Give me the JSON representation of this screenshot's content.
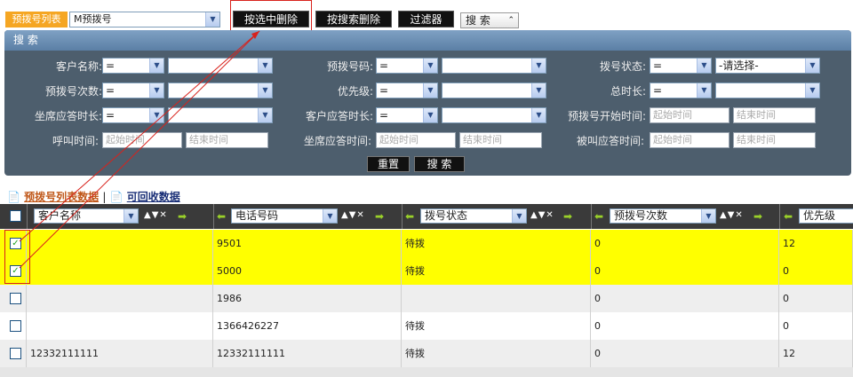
{
  "toolbar": {
    "list_label": "预拨号列表",
    "list_value": "M预拨号",
    "btn_delete_selected": "按选中删除",
    "btn_delete_search": "按搜索删除",
    "btn_filter": "过滤器",
    "search_toggle": "搜 索"
  },
  "panel": {
    "title": "搜 索",
    "op_eq": "=",
    "please_select": "-请选择-",
    "start_time_ph": "起始时间",
    "end_time_ph": "结束时间",
    "labels": {
      "customer_name": "客户名称:",
      "pre_number": "预拨号码:",
      "dial_status": "拨号状态:",
      "dial_count": "预拨号次数:",
      "priority": "优先级:",
      "total_duration": "总时长:",
      "agent_answer": "坐席应答时长:",
      "customer_answer": "客户应答时长:",
      "pre_start_time": "预拨号开始时间:",
      "call_time": "呼叫时间:",
      "agent_answer_time": "坐席应答时间:",
      "called_answer_time": "被叫应答时间:"
    },
    "reset": "重置",
    "search": "搜 索"
  },
  "tabs": {
    "active": "预拨号列表数据",
    "separator": "|",
    "other": "可回收数据"
  },
  "table": {
    "columns": [
      "客户名称",
      "电话号码",
      "拨号状态",
      "预拨号次数",
      "优先级"
    ],
    "rows": [
      {
        "checked": true,
        "name": "",
        "phone": "9501",
        "status": "待拨",
        "count": "0",
        "priority": "12",
        "highlight": true
      },
      {
        "checked": true,
        "name": "",
        "phone": "5000",
        "status": "待拨",
        "count": "0",
        "priority": "0",
        "highlight": true
      },
      {
        "checked": false,
        "name": "",
        "phone": "1986",
        "status": "",
        "count": "0",
        "priority": "0",
        "highlight": false
      },
      {
        "checked": false,
        "name": "",
        "phone": "1366426227",
        "status": "待拨",
        "count": "0",
        "priority": "0",
        "highlight": false
      },
      {
        "checked": false,
        "name": "12332111111",
        "phone": "12332111111",
        "status": "待拨",
        "count": "0",
        "priority": "12",
        "highlight": false
      }
    ]
  },
  "colors": {
    "highlight_row": "#ffff00",
    "alt_row": "#eeeeee",
    "annotation_red": "#d8221c",
    "panel_bg": "#4d5e6d"
  }
}
